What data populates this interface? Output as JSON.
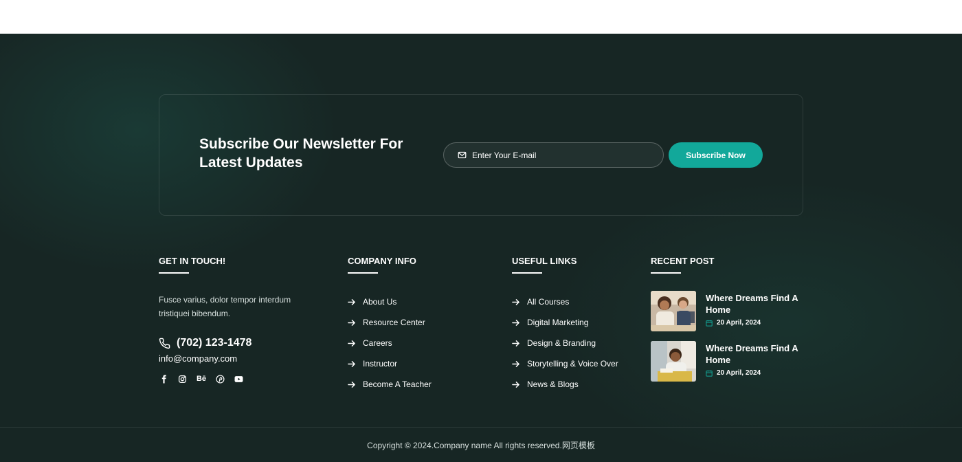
{
  "newsletter": {
    "title": "Subscribe Our Newsletter For Latest Updates",
    "email_placeholder": "Enter Your E-mail",
    "email_value": "",
    "button_label": "Subscribe Now"
  },
  "contact": {
    "heading": "GET IN TOUCH!",
    "text": "Fusce varius, dolor tempor interdum tristiquei bibendum.",
    "phone": "(702) 123-1478",
    "email": "info@company.com",
    "socials": [
      "facebook-icon",
      "instagram-icon",
      "behance-icon",
      "pinterest-icon",
      "youtube-icon"
    ],
    "behance_label": "Bē"
  },
  "company_info": {
    "heading": "COMPANY INFO",
    "items": [
      {
        "label": "About Us"
      },
      {
        "label": "Resource Center"
      },
      {
        "label": "Careers"
      },
      {
        "label": "Instructor"
      },
      {
        "label": "Become A Teacher"
      }
    ]
  },
  "useful_links": {
    "heading": "USEFUL LINKS",
    "items": [
      {
        "label": "All Courses"
      },
      {
        "label": "Digital Marketing"
      },
      {
        "label": "Design & Branding"
      },
      {
        "label": "Storytelling & Voice Over"
      },
      {
        "label": "News & Blogs"
      }
    ]
  },
  "recent_post": {
    "heading": "RECENT POST",
    "posts": [
      {
        "title": "Where Dreams Find A Home",
        "date": "20 April, 2024"
      },
      {
        "title": "Where Dreams Find A Home",
        "date": "20 April, 2024"
      }
    ]
  },
  "footer": {
    "copyright": "Copyright © 2024.Company name All rights reserved.网页模板"
  },
  "colors": {
    "background": "#172624",
    "accent": "#12a89a",
    "text": "#ffffff"
  }
}
